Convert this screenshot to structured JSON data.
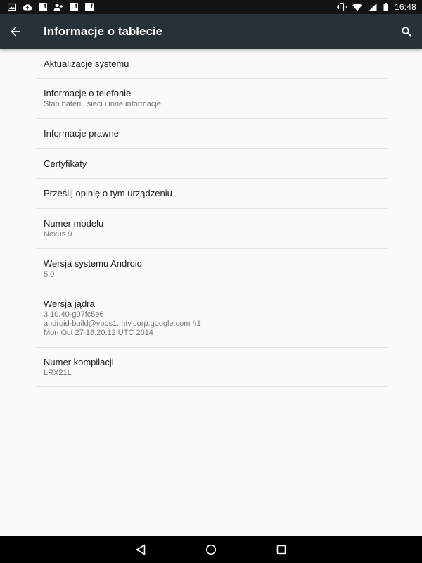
{
  "status_bar": {
    "time": "16:48",
    "left_icons": [
      "image-icon",
      "cloud-upload-icon",
      "facebook-icon",
      "add-person-icon",
      "facebook-icon",
      "facebook-icon"
    ],
    "right_icons": [
      "vibrate-icon",
      "wifi-icon",
      "signal-icon",
      "battery-icon"
    ]
  },
  "app_bar": {
    "title": "Informacje o tablecie",
    "background": "#263238"
  },
  "items": [
    {
      "title": "Aktualizacje systemu",
      "summary": ""
    },
    {
      "title": "Informacje o telefonie",
      "summary": "Stan baterii, sieci i inne informacje"
    },
    {
      "title": "Informacje prawne",
      "summary": ""
    },
    {
      "title": "Certyfikaty",
      "summary": ""
    },
    {
      "title": "Prześlij opinię o tym urządzeniu",
      "summary": ""
    },
    {
      "title": "Numer modelu",
      "summary": "Nexus 9"
    },
    {
      "title": "Wersja systemu Android",
      "summary": "5.0"
    },
    {
      "title": "Wersja jądra",
      "summary_lines": [
        "3.10.40-g07fc5e6",
        "android-build@vpbs1.mtv.corp.google.com #1",
        "Mon Oct 27 18:20:12 UTC 2014"
      ]
    },
    {
      "title": "Numer kompilacji",
      "summary": "LRX21L"
    }
  ],
  "nav_bar": {
    "buttons": [
      "back-nav-icon",
      "home-nav-icon",
      "recents-nav-icon"
    ]
  }
}
